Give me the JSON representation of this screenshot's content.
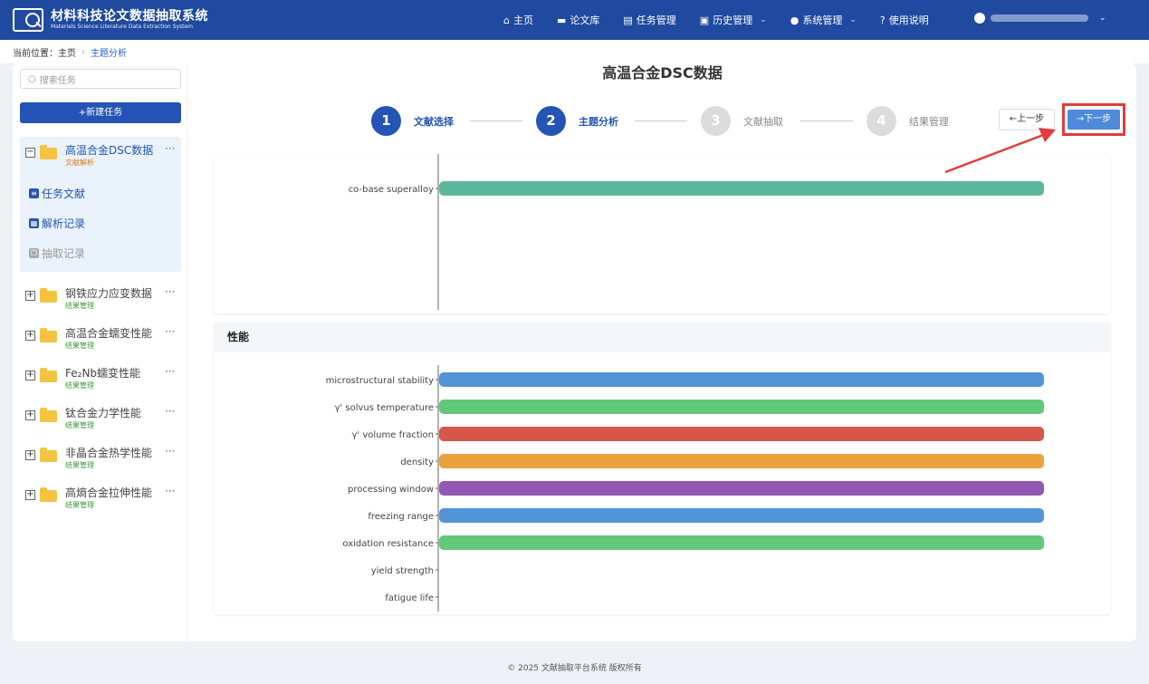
{
  "app": {
    "title": "材料科技论文数据抽取系统",
    "subtitle": "Materials Science Literature Data Extraction System"
  },
  "nav": {
    "items": [
      {
        "icon": "home-icon",
        "label": "主页"
      },
      {
        "icon": "library-icon",
        "label": "论文库"
      },
      {
        "icon": "task-icon",
        "label": "任务管理"
      },
      {
        "icon": "history-icon",
        "label": "历史管理"
      },
      {
        "icon": "system-icon",
        "label": "系统管理"
      },
      {
        "icon": "help-icon",
        "label": "使用说明"
      }
    ]
  },
  "breadcrumb": {
    "prefix": "当前位置：",
    "home": "主页",
    "current": "主题分析"
  },
  "sidebar": {
    "search_placeholder": "搜索任务",
    "new_task": "+新建任务",
    "active_task": {
      "name": "高温合金DSC数据",
      "status": "文献解析",
      "sub_items": [
        "任务文献",
        "解析记录",
        "抽取记录"
      ]
    },
    "tasks": [
      {
        "name": "钢铁应力应变数据",
        "status": "结果管理"
      },
      {
        "name": "高温合金蠕变性能",
        "status": "结果管理"
      },
      {
        "name": "Fe₂Nb蠕变性能",
        "status": "结果管理"
      },
      {
        "name": "钛合金力学性能",
        "status": "结果管理"
      },
      {
        "name": "非晶合金热学性能",
        "status": "结果管理"
      },
      {
        "name": "高熵合金拉伸性能",
        "status": "结果管理"
      }
    ],
    "more": "···"
  },
  "main": {
    "title": "高温合金DSC数据",
    "steps": [
      {
        "num": "1",
        "label": "文献选择",
        "active": true
      },
      {
        "num": "2",
        "label": "主题分析",
        "active": true
      },
      {
        "num": "3",
        "label": "文献抽取",
        "active": false
      },
      {
        "num": "4",
        "label": "结果管理",
        "active": false
      }
    ],
    "prev": "←上一步",
    "next": "→下一步"
  },
  "chart_data": [
    {
      "type": "bar",
      "orientation": "horizontal",
      "categories": [
        "co-base superalloy"
      ],
      "values": [
        1
      ],
      "colors": [
        "#5bb89a"
      ],
      "xlim": [
        0,
        1
      ]
    },
    {
      "type": "bar",
      "orientation": "horizontal",
      "title": "性能",
      "categories": [
        "microstructural stability",
        "γ' solvus temperature",
        "γ' volume fraction",
        "density",
        "processing window",
        "freezing range",
        "oxidation resistance",
        "yield strength",
        "fatigue life"
      ],
      "values": [
        1,
        1,
        1,
        1,
        1,
        1,
        1,
        0,
        0
      ],
      "colors": [
        "#5393d8",
        "#62c97a",
        "#d6574a",
        "#e9a23c",
        "#9258b3",
        "#5393d8",
        "#62c97a",
        "#5393d8",
        "#62c97a"
      ],
      "xlim": [
        0,
        1
      ]
    }
  ],
  "footer": "© 2025 文献抽取平台系统 版权所有"
}
